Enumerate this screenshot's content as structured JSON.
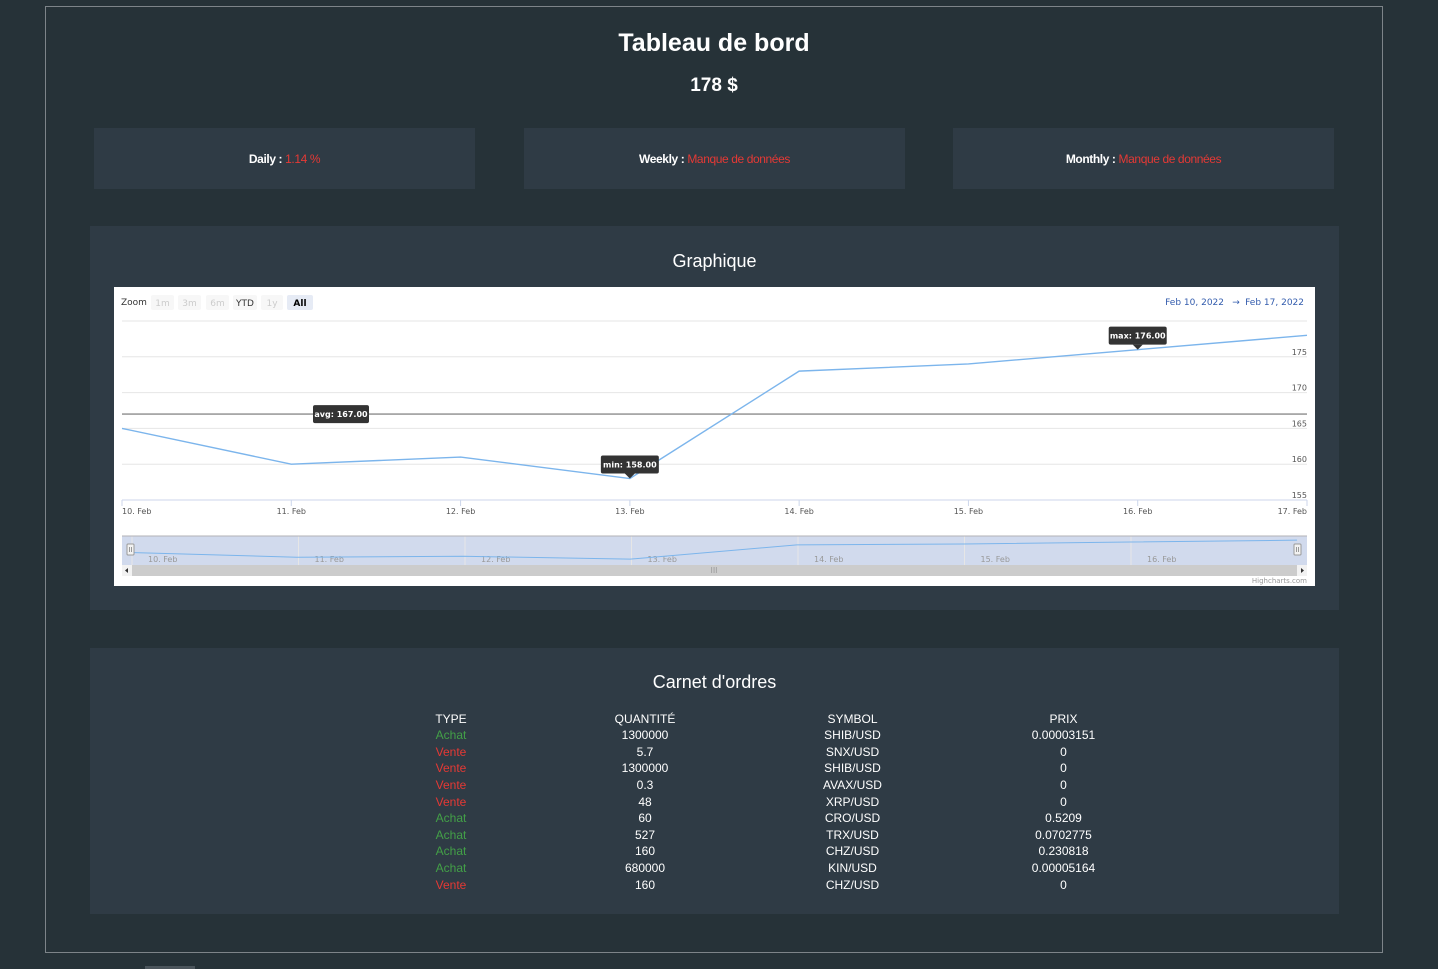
{
  "header": {
    "title": "Tableau de bord",
    "total": "178 $"
  },
  "stats": [
    {
      "label": "Daily :",
      "value": "1.14 %"
    },
    {
      "label": "Weekly :",
      "value": "Manque de données"
    },
    {
      "label": "Monthly :",
      "value": "Manque de données"
    }
  ],
  "chart_panel": {
    "title": "Graphique"
  },
  "range_selector": {
    "zoom_label": "Zoom",
    "buttons": [
      {
        "label": "1m",
        "state": "disabled"
      },
      {
        "label": "3m",
        "state": "disabled"
      },
      {
        "label": "6m",
        "state": "disabled"
      },
      {
        "label": "YTD",
        "state": "normal"
      },
      {
        "label": "1y",
        "state": "disabled"
      },
      {
        "label": "All",
        "state": "selected"
      }
    ],
    "from": "Feb 10, 2022",
    "separator": "→",
    "to": "Feb 17, 2022"
  },
  "credits": "Highcharts.com",
  "chart_data": {
    "type": "line",
    "x": [
      "10. Feb",
      "11. Feb",
      "12. Feb",
      "13. Feb",
      "14. Feb",
      "15. Feb",
      "16. Feb",
      "17. Feb"
    ],
    "series": [
      {
        "values": [
          165,
          160,
          161,
          158,
          173,
          174,
          176,
          178
        ]
      }
    ],
    "ylim": [
      155,
      180
    ],
    "yticks": [
      155,
      160,
      165,
      170,
      175
    ],
    "plot_lines": [
      {
        "label": "avg: 167.00",
        "value": 167
      }
    ],
    "annotations": [
      {
        "label": "min: 158.00",
        "x": "13. Feb",
        "value": 158
      },
      {
        "label": "max: 176.00",
        "x": "16. Feb",
        "value": 176
      }
    ],
    "navigator_x": [
      "10. Feb",
      "11. Feb",
      "12. Feb",
      "13. Feb",
      "14. Feb",
      "15. Feb",
      "16. Feb"
    ],
    "grid": true,
    "colors": {
      "line": "#7cb5ec",
      "navigator_fill": "#ccd6eb"
    }
  },
  "orders_panel": {
    "title": "Carnet d'ordres",
    "columns": [
      "TYPE",
      "QUANTITÉ",
      "SYMBOL",
      "PRIX"
    ],
    "rows": [
      {
        "type": "Achat",
        "qty": "1300000",
        "symbol": "SHIB/USD",
        "price": "0.00003151"
      },
      {
        "type": "Vente",
        "qty": "5.7",
        "symbol": "SNX/USD",
        "price": "0"
      },
      {
        "type": "Vente",
        "qty": "1300000",
        "symbol": "SHIB/USD",
        "price": "0"
      },
      {
        "type": "Vente",
        "qty": "0.3",
        "symbol": "AVAX/USD",
        "price": "0"
      },
      {
        "type": "Vente",
        "qty": "48",
        "symbol": "XRP/USD",
        "price": "0"
      },
      {
        "type": "Achat",
        "qty": "60",
        "symbol": "CRO/USD",
        "price": "0.5209"
      },
      {
        "type": "Achat",
        "qty": "527",
        "symbol": "TRX/USD",
        "price": "0.0702775"
      },
      {
        "type": "Achat",
        "qty": "160",
        "symbol": "CHZ/USD",
        "price": "0.230818"
      },
      {
        "type": "Achat",
        "qty": "680000",
        "symbol": "KIN/USD",
        "price": "0.00005164"
      },
      {
        "type": "Vente",
        "qty": "160",
        "symbol": "CHZ/USD",
        "price": "0"
      }
    ]
  },
  "colors": {
    "buy": "#43a047",
    "sell": "#e53935",
    "background": "#263238",
    "panel": "#2f3b45"
  }
}
